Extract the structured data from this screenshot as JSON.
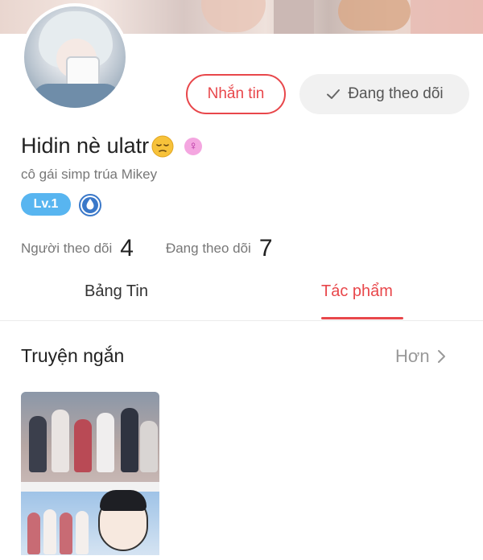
{
  "profile": {
    "name": "Hidin nè ulatr",
    "bio": "cô gái simp trúa Mikey",
    "level": "Lv.1"
  },
  "actions": {
    "message_label": "Nhắn tin",
    "following_label": "Đang theo dõi"
  },
  "stats": {
    "followers_label": "Người theo dõi",
    "followers_count": "4",
    "following_label": "Đang theo dõi",
    "following_count": "7"
  },
  "tabs": [
    {
      "label": "Bảng Tin",
      "active": false
    },
    {
      "label": "Tác phẩm",
      "active": true
    }
  ],
  "section": {
    "title": "Truyện ngắn",
    "more_label": "Hơn"
  },
  "icons": {
    "emoji": "pensive-face-icon",
    "gender": "female-icon",
    "badge": "water-drop-badge-icon",
    "check": "check-icon",
    "chevron": "chevron-right-icon"
  },
  "colors": {
    "accent": "#e8474b",
    "level_badge": "#58b5f0",
    "muted_text": "#777777"
  }
}
